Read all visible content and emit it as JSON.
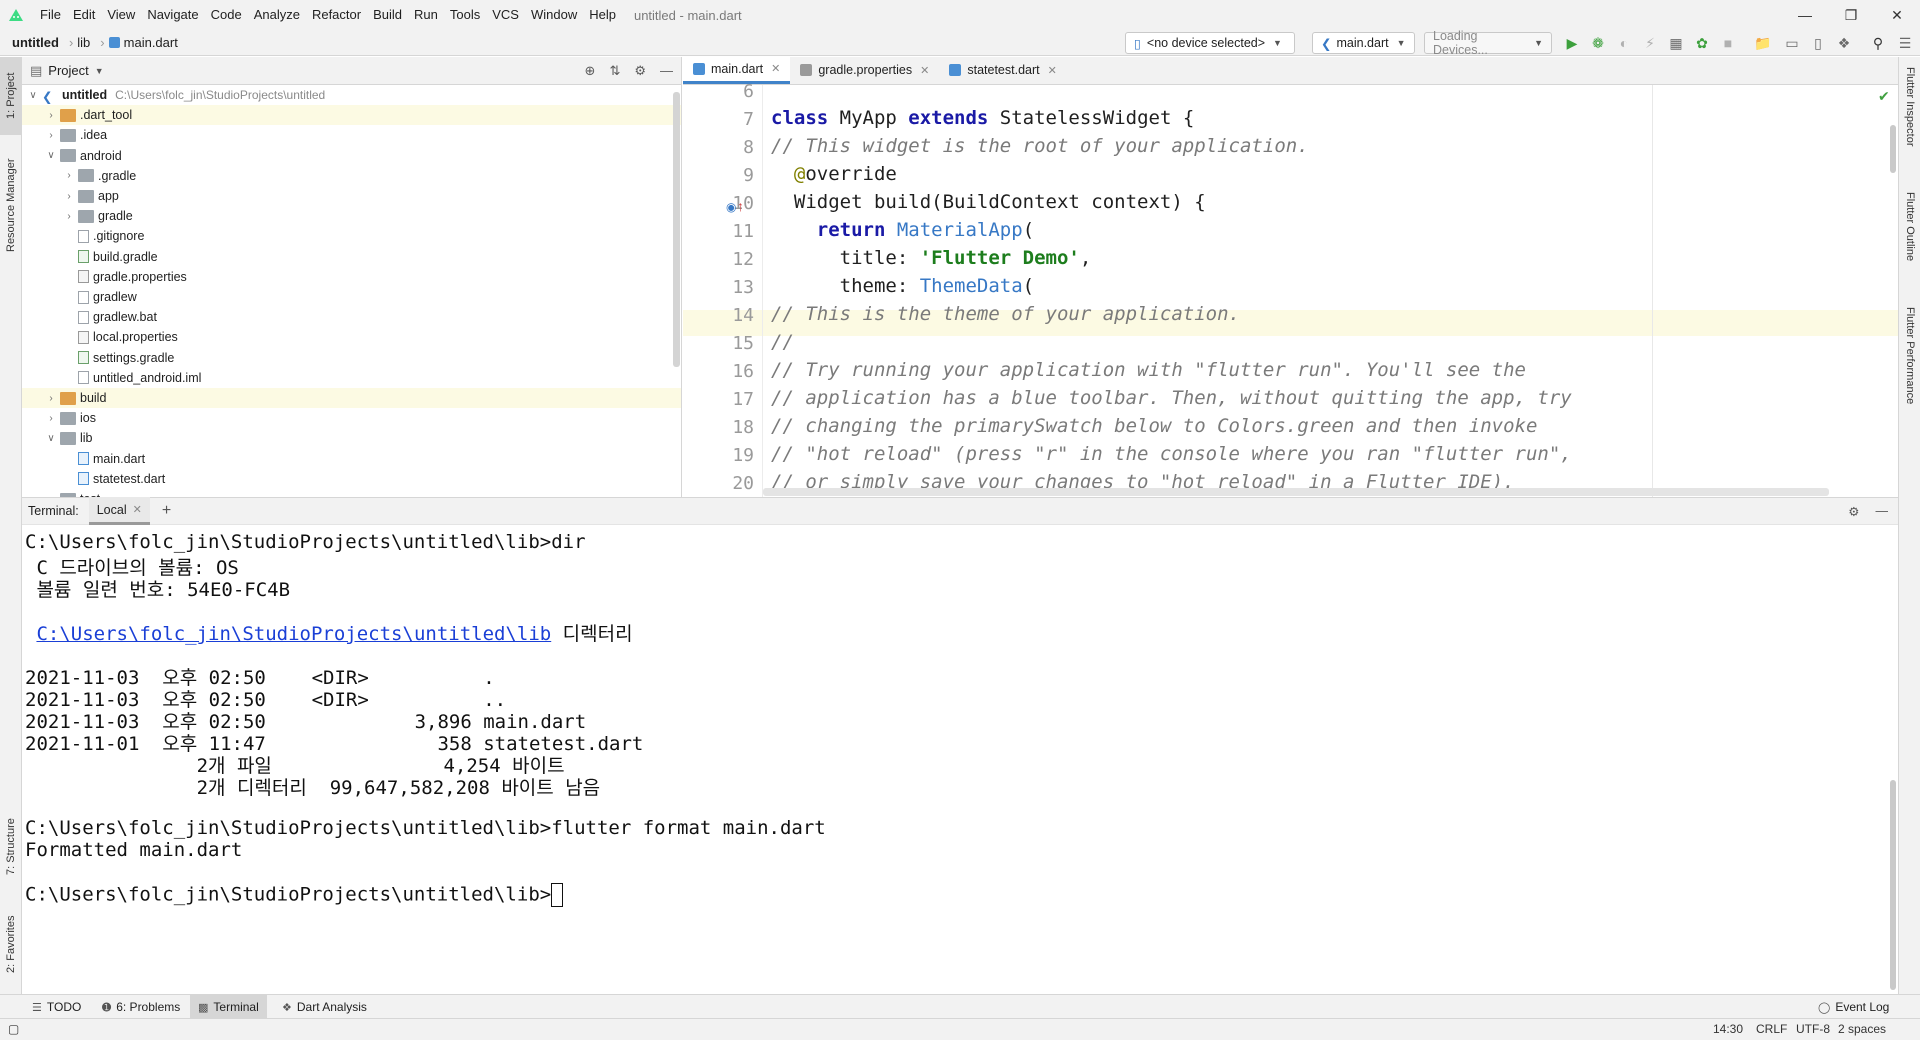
{
  "menubar": {
    "items": [
      "File",
      "Edit",
      "View",
      "Navigate",
      "Code",
      "Analyze",
      "Refactor",
      "Build",
      "Run",
      "Tools",
      "VCS",
      "Window",
      "Help"
    ],
    "window_title": "untitled - main.dart"
  },
  "navbar": {
    "crumbs": [
      "untitled",
      "lib",
      "main.dart"
    ],
    "device_combo": "<no device selected>",
    "run_config": "main.dart",
    "loading_combo": "Loading Devices..."
  },
  "left_strip": {
    "project_tab": "1: Project",
    "resource_tab": "Resource Manager",
    "structure_tab": "7: Structure",
    "favorites_tab": "2: Favorites"
  },
  "right_strip": {
    "inspector": "Flutter Inspector",
    "outline": "Flutter Outline",
    "performance": "Flutter Performance"
  },
  "project": {
    "title": "Project",
    "tree": [
      {
        "label": "untitled",
        "path": "C:\\Users\\folc_jin\\StudioProjects\\untitled",
        "depth": 0,
        "expanded": true,
        "kind": "module",
        "bold": true
      },
      {
        "label": ".dart_tool",
        "depth": 1,
        "expanded": false,
        "kind": "folder-orange",
        "hl": true
      },
      {
        "label": ".idea",
        "depth": 1,
        "expanded": false,
        "kind": "folder"
      },
      {
        "label": "android",
        "depth": 1,
        "expanded": true,
        "kind": "folder"
      },
      {
        "label": ".gradle",
        "depth": 2,
        "expanded": false,
        "kind": "folder"
      },
      {
        "label": "app",
        "depth": 2,
        "expanded": false,
        "kind": "folder"
      },
      {
        "label": "gradle",
        "depth": 2,
        "expanded": false,
        "kind": "folder"
      },
      {
        "label": ".gitignore",
        "depth": 2,
        "kind": "file"
      },
      {
        "label": "build.gradle",
        "depth": 2,
        "kind": "gradle"
      },
      {
        "label": "gradle.properties",
        "depth": 2,
        "kind": "props"
      },
      {
        "label": "gradlew",
        "depth": 2,
        "kind": "file"
      },
      {
        "label": "gradlew.bat",
        "depth": 2,
        "kind": "file"
      },
      {
        "label": "local.properties",
        "depth": 2,
        "kind": "props"
      },
      {
        "label": "settings.gradle",
        "depth": 2,
        "kind": "gradle"
      },
      {
        "label": "untitled_android.iml",
        "depth": 2,
        "kind": "file"
      },
      {
        "label": "build",
        "depth": 1,
        "expanded": false,
        "kind": "folder-orange",
        "hl": true
      },
      {
        "label": "ios",
        "depth": 1,
        "expanded": false,
        "kind": "folder"
      },
      {
        "label": "lib",
        "depth": 1,
        "expanded": true,
        "kind": "folder"
      },
      {
        "label": "main.dart",
        "depth": 2,
        "kind": "dart"
      },
      {
        "label": "statetest.dart",
        "depth": 2,
        "kind": "dart"
      },
      {
        "label": "test",
        "depth": 1,
        "expanded": false,
        "kind": "folder"
      }
    ]
  },
  "editor": {
    "tabs": [
      {
        "label": "main.dart",
        "active": true
      },
      {
        "label": "gradle.properties",
        "active": false
      },
      {
        "label": "statetest.dart",
        "active": false
      }
    ],
    "lines": [
      {
        "n": "6",
        "segs": []
      },
      {
        "n": "7",
        "segs": [
          [
            "kw",
            "class"
          ],
          [
            "",
            " MyApp "
          ],
          [
            "kw",
            "extends"
          ],
          [
            "",
            " StatelessWidget {"
          ]
        ]
      },
      {
        "n": "8",
        "segs": [
          [
            "cm",
            "// This widget is the root of your application."
          ]
        ]
      },
      {
        "n": "9",
        "segs": [
          [
            "",
            "  "
          ],
          [
            "ann",
            "@"
          ],
          [
            "",
            "override"
          ]
        ]
      },
      {
        "n": "10",
        "segs": [
          [
            "",
            "  Widget build(BuildContext context) {"
          ]
        ]
      },
      {
        "n": "11",
        "segs": [
          [
            "",
            "    "
          ],
          [
            "kw",
            "return"
          ],
          [
            "",
            " "
          ],
          [
            "ty",
            "MaterialApp"
          ],
          [
            "",
            "("
          ]
        ]
      },
      {
        "n": "12",
        "segs": [
          [
            "",
            "      title: "
          ],
          [
            "st",
            "'Flutter Demo'"
          ],
          [
            "",
            ","
          ]
        ]
      },
      {
        "n": "13",
        "segs": [
          [
            "",
            "      theme: "
          ],
          [
            "ty",
            "ThemeData"
          ],
          [
            "",
            "("
          ]
        ]
      },
      {
        "n": "14",
        "segs": [
          [
            "cm",
            "// This is the theme of your application."
          ]
        ]
      },
      {
        "n": "15",
        "segs": [
          [
            "cm",
            "//"
          ]
        ]
      },
      {
        "n": "16",
        "segs": [
          [
            "cm",
            "// Try running your application with \"flutter run\". You'll see the"
          ]
        ]
      },
      {
        "n": "17",
        "segs": [
          [
            "cm",
            "// application has a blue toolbar. Then, without quitting the app, try"
          ]
        ]
      },
      {
        "n": "18",
        "segs": [
          [
            "cm",
            "// changing the primarySwatch below to Colors.green and then invoke"
          ]
        ]
      },
      {
        "n": "19",
        "segs": [
          [
            "cm",
            "// \"hot reload\" (press \"r\" in the console where you ran \"flutter run\","
          ]
        ]
      },
      {
        "n": "20",
        "segs": [
          [
            "cm",
            "// or simply save your changes to \"hot reload\" in a Flutter IDE)."
          ]
        ]
      }
    ]
  },
  "terminal": {
    "label": "Terminal:",
    "tab": "Local",
    "lines": [
      {
        "t": "C:\\Users\\folc_jin\\StudioProjects\\untitled\\lib>dir"
      },
      {
        "t": " C 드라이브의 볼륨: OS"
      },
      {
        "t": " 볼륨 일련 번호: 54E0-FC4B"
      },
      {
        "t": ""
      },
      {
        "link": "C:\\Users\\folc_jin\\StudioProjects\\untitled\\lib",
        "t": " 디렉터리"
      },
      {
        "t": ""
      },
      {
        "t": "2021-11-03  오후 02:50    <DIR>          ."
      },
      {
        "t": "2021-11-03  오후 02:50    <DIR>          .."
      },
      {
        "t": "2021-11-03  오후 02:50             3,896 main.dart"
      },
      {
        "t": "2021-11-01  오후 11:47               358 statetest.dart"
      },
      {
        "t": "               2개 파일               4,254 바이트"
      },
      {
        "t": "               2개 디렉터리  99,647,582,208 바이트 남음"
      },
      {
        "t": ""
      },
      {
        "t": "C:\\Users\\folc_jin\\StudioProjects\\untitled\\lib>flutter format main.dart"
      },
      {
        "t": "Formatted main.dart"
      },
      {
        "t": ""
      },
      {
        "t": "C:\\Users\\folc_jin\\StudioProjects\\untitled\\lib>",
        "cursor": true
      }
    ]
  },
  "bottombar": {
    "todo": "TODO",
    "problems": "6: Problems",
    "terminal": "Terminal",
    "dart_analysis": "Dart Analysis",
    "event_log": "Event Log"
  },
  "status": {
    "position": "14:30",
    "line_sep": "CRLF",
    "encoding": "UTF-8",
    "indent": "2 spaces"
  },
  "colors": {
    "accent": "#4083c9",
    "keyword": "#1a1aa6",
    "string": "#1d7d1d",
    "comment": "#7a7a7a",
    "type": "#3778c5",
    "link": "#1a3fd6",
    "run_green": "#3ca03c"
  }
}
